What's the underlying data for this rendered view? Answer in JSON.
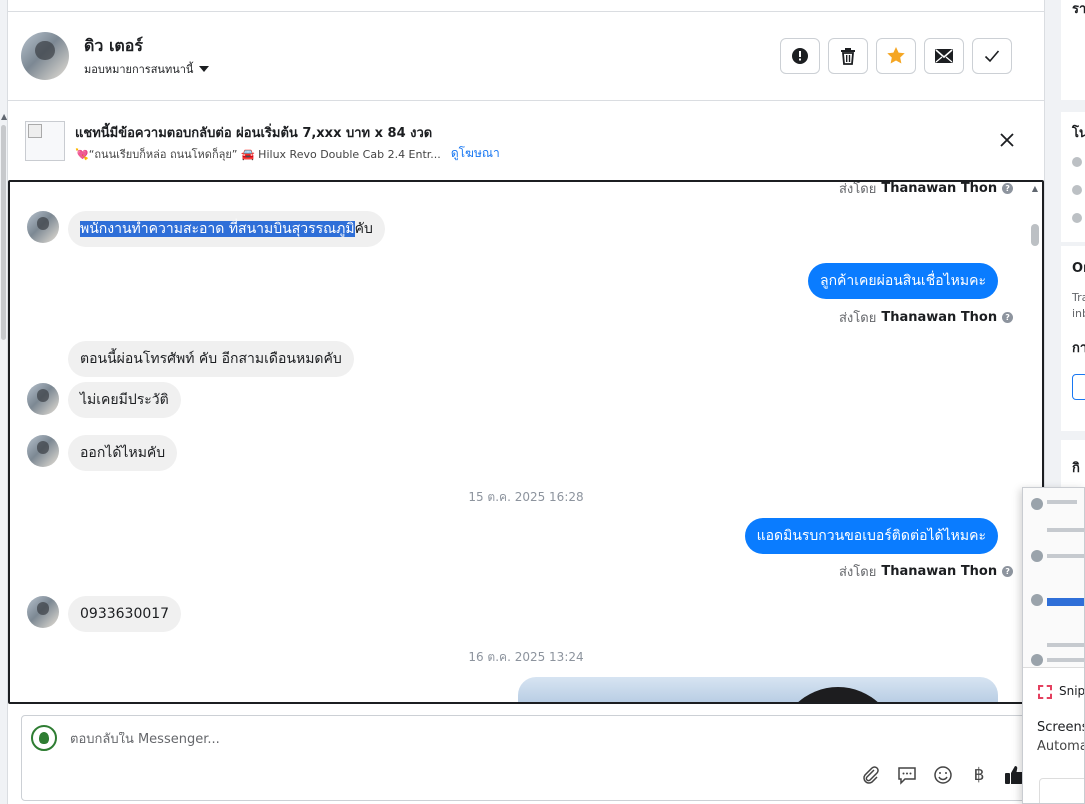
{
  "header": {
    "contact_name": "ดิว เตอร์",
    "assign_label": "มอบหมายการสนทนานี้",
    "actions": [
      {
        "name": "report-button",
        "icon": "exclamation-circle-icon"
      },
      {
        "name": "delete-button",
        "icon": "trash-icon"
      },
      {
        "name": "star-button",
        "icon": "star-icon",
        "color": "#f5a623"
      },
      {
        "name": "mark-unread-button",
        "icon": "envelope-icon"
      },
      {
        "name": "mark-done-button",
        "icon": "check-icon"
      }
    ]
  },
  "ad": {
    "title": "แชทนี้มีข้อความตอบกลับต่อ ผ่อนเริ่มต้น 7,xxx บาท x 84 งวด",
    "subtitle": "💘“ถนนเรียบก็หล่อ ถนนโหดก็ลุย” 🚘 Hilux Revo Double Cab 2.4 Entr...",
    "link": "ดูโฆษณา"
  },
  "thread": {
    "sender_prefix": "ส่งโดย",
    "sender_name": "Thanawan Thon",
    "messages": [
      {
        "dir": "in",
        "text_selected": "พนักงานทำความสะอาด ที่สนามบินสุวรรณภูมิ",
        "text_rest": "คับ"
      },
      {
        "dir": "out",
        "text": "ลูกค้าเคยผ่อนสินเชื่อไหมคะ"
      },
      {
        "dir": "in",
        "text": "ตอนนี้ผ่อนโทรศัพท์ คับ อีกสามเดือนหมดคับ"
      },
      {
        "dir": "in",
        "text": "ไม่เคยมีประวัติ"
      },
      {
        "dir": "in",
        "text": "ออกได้ไหมคับ"
      },
      {
        "dir": "time",
        "text": "15 ต.ค. 2025 16:28"
      },
      {
        "dir": "out",
        "text": "แอดมินรบกวนขอเบอร์ติดต่อได้ไหมคะ"
      },
      {
        "dir": "in",
        "text": "0933630017"
      },
      {
        "dir": "time",
        "text": "16 ต.ค. 2025 13:24"
      }
    ]
  },
  "composer": {
    "placeholder": "ตอบกลับใน Messenger...",
    "tools": [
      "paperclip-icon",
      "chat-bubble-icon",
      "emoji-icon",
      "baht-icon",
      "thumbs-up-icon"
    ],
    "baht_symbol": "฿"
  },
  "right_panel": {
    "heading1": "รา",
    "heading2": "โน",
    "heading3": "Or",
    "small1": "Tra",
    "small2": "inb",
    "heading4": "กา",
    "heading5": "กิ"
  },
  "snip": {
    "title": "Snip",
    "line1": "Screens",
    "line2": "Automa"
  },
  "colors": {
    "outgoing_bubble": "#0a7cff",
    "incoming_bubble": "#f0f0f0",
    "selection": "#2f6fd8",
    "link": "#1877f2"
  }
}
